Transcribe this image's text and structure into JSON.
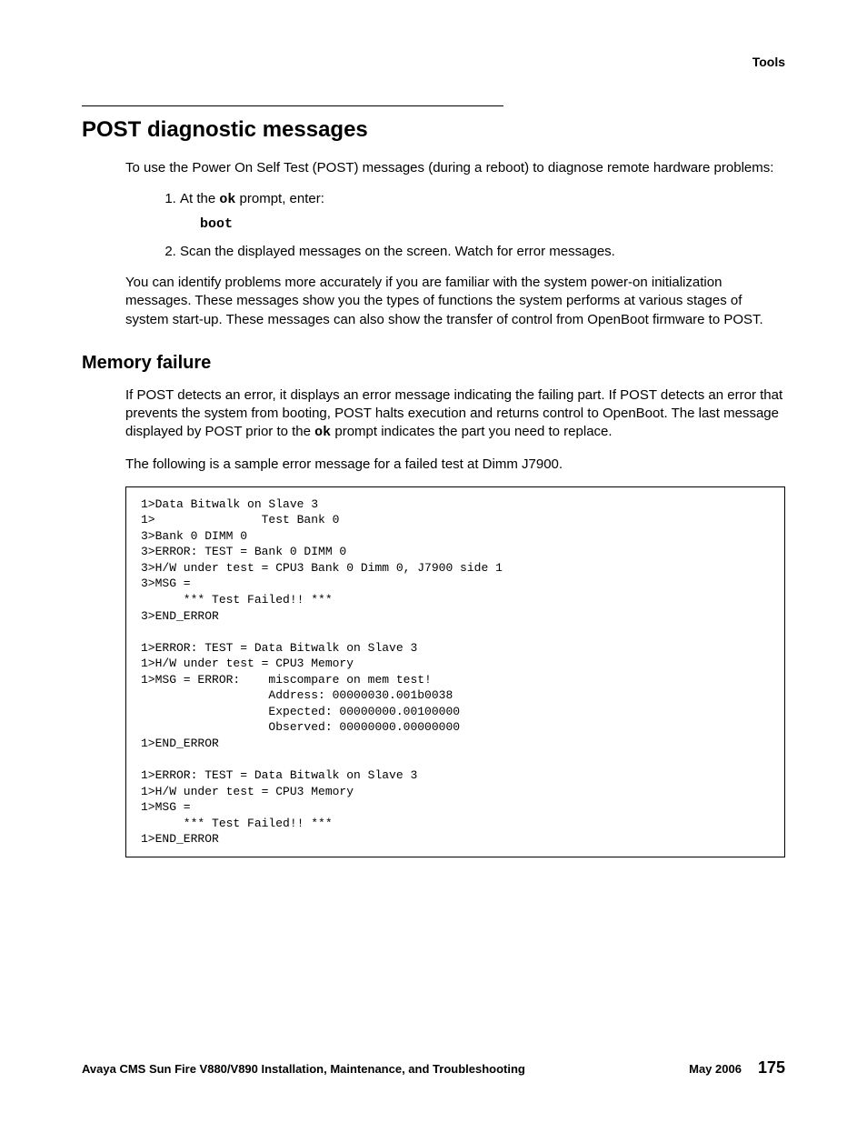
{
  "header": {
    "right": "Tools"
  },
  "section": {
    "title": "POST diagnostic messages",
    "intro": "To use the Power On Self Test (POST) messages (during a reboot) to diagnose remote hardware problems:",
    "step1_prefix": "At the ",
    "step1_mono": "ok",
    "step1_suffix": " prompt, enter:",
    "step1_cmd": "boot",
    "step2": "Scan the displayed messages on the screen. Watch for error messages.",
    "followup": "You can identify problems more accurately if you are familiar with the system power-on initialization messages. These messages show you the types of functions the system performs at various stages of system start-up. These messages can also show the transfer of control from OpenBoot firmware to POST."
  },
  "subsection": {
    "title": "Memory failure",
    "p1_a": "If POST detects an error, it displays an error message indicating the failing part. If POST detects an error that prevents the system from booting, POST halts execution and returns control to OpenBoot. The last message displayed by POST prior to the ",
    "p1_mono": "ok",
    "p1_b": " prompt indicates the part you need to replace.",
    "p2": "The following is a sample error message for a failed test at Dimm J7900."
  },
  "code": "1>Data Bitwalk on Slave 3\n1>               Test Bank 0\n3>Bank 0 DIMM 0\n3>ERROR: TEST = Bank 0 DIMM 0\n3>H/W under test = CPU3 Bank 0 Dimm 0, J7900 side 1\n3>MSG =\n      *** Test Failed!! ***\n3>END_ERROR\n\n1>ERROR: TEST = Data Bitwalk on Slave 3\n1>H/W under test = CPU3 Memory\n1>MSG = ERROR:    miscompare on mem test!\n                  Address: 00000030.001b0038\n                  Expected: 00000000.00100000\n                  Observed: 00000000.00000000\n1>END_ERROR\n\n1>ERROR: TEST = Data Bitwalk on Slave 3\n1>H/W under test = CPU3 Memory\n1>MSG =\n      *** Test Failed!! ***\n1>END_ERROR",
  "footer": {
    "left": "Avaya CMS Sun Fire V880/V890 Installation, Maintenance, and Troubleshooting",
    "date": "May 2006",
    "page": "175"
  }
}
